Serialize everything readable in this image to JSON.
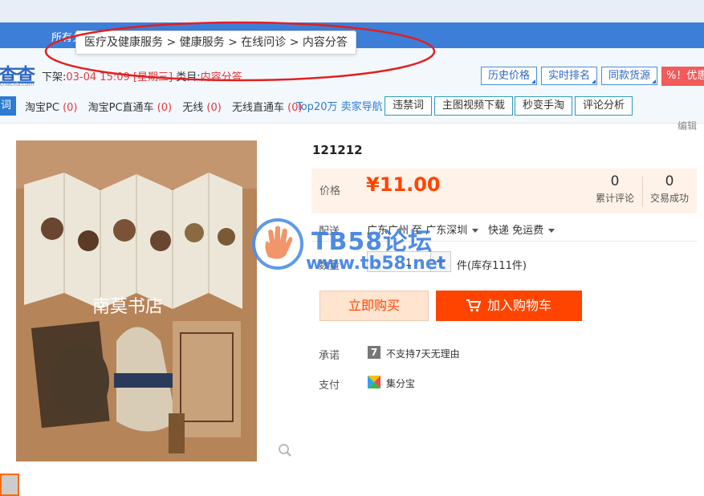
{
  "browser": {
    "nav_text": "所有分"
  },
  "tooltip": {
    "breadcrumb": "医疗及健康服务 > 健康服务 > 在线问诊 > 内容分答"
  },
  "plugin": {
    "logo": "查查",
    "logo_sub": "chacha.com",
    "shelf_label": "下架:",
    "shelf_time": "03-04 15:09 [星期三]",
    "category_label": "类目:",
    "category_value": "内容分答",
    "buttons": [
      "历史价格",
      "实时排名",
      "同款货源"
    ],
    "promo": "%！优惠",
    "row2_tag": "词",
    "row2_items": [
      {
        "label": "淘宝PC",
        "count": "(0)"
      },
      {
        "label": "淘宝PC直通车",
        "count": "(0)"
      },
      {
        "label": "无线",
        "count": "(0)"
      },
      {
        "label": "无线直通车",
        "count": "(0)"
      }
    ],
    "top20": "Top20万",
    "seller_nav": "卖家导航",
    "row2_buttons": [
      "违禁词",
      "主图视频下载",
      "秒变手淘",
      "评论分析"
    ],
    "edit": "编辑"
  },
  "product": {
    "image_watermark": "南莫书店",
    "title": "121212",
    "price_label": "价格",
    "price": "¥11.00",
    "reviews_count": "0",
    "reviews_label": "累计评论",
    "sales_count": "0",
    "sales_label": "交易成功",
    "shipping_label": "配送",
    "shipping_route": "广东广州 至 广东深圳",
    "shipping_method": "快递 免运费",
    "qty_label": "数量",
    "qty_value": "1",
    "qty_minus": "-",
    "qty_plus": "+",
    "stock": "件(库存111件)",
    "buy_now": "立即购买",
    "add_cart": "加入购物车",
    "promise_label": "承诺",
    "promise_icon": "7",
    "promise_text": "不支持7天无理由",
    "pay_label": "支付",
    "pay_text": "集分宝"
  },
  "watermark": {
    "title": "TB58论坛",
    "url": "www.tb58.net"
  },
  "colors": {
    "accent": "#ff4400",
    "brand_blue": "#2d7bd3",
    "annotation_red": "#e02020"
  },
  "icons": [
    "zoom-icon",
    "cart-icon",
    "caret-down-icon",
    "seven-day-icon",
    "jifenbao-icon",
    "hand-logo-icon"
  ]
}
